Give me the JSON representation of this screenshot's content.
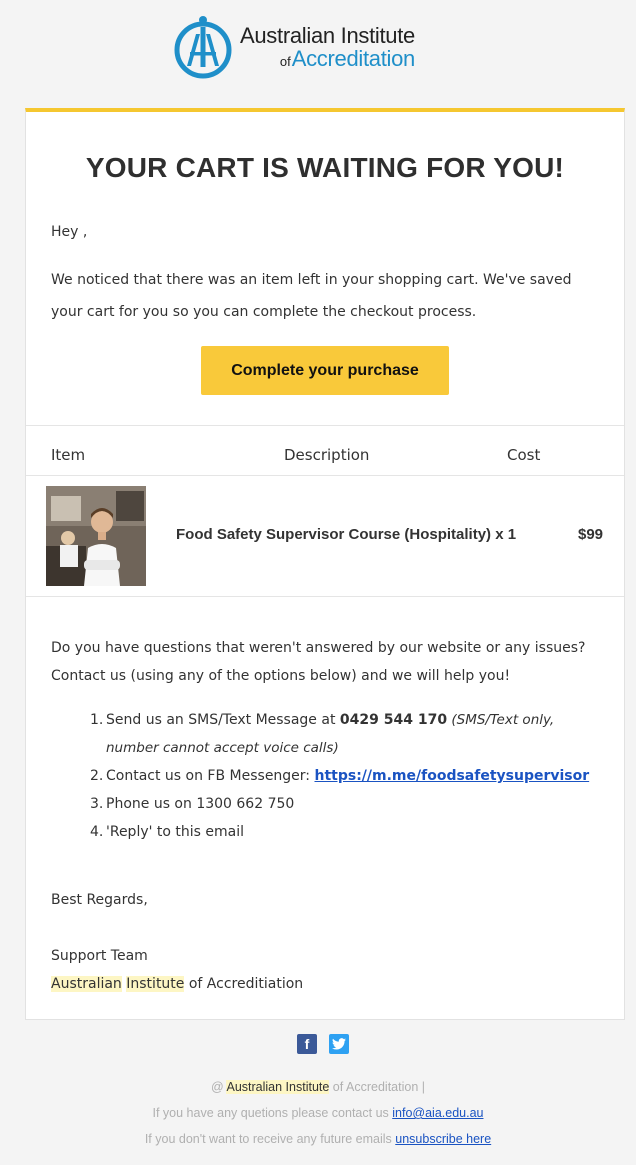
{
  "brand": {
    "name_line1": "Australian Institute",
    "name_of": "of",
    "name_line2": "Accreditation",
    "accent_color": "#1f8fc9",
    "highlight_color": "#f5c730"
  },
  "email": {
    "title": "YOUR CART IS WAITING FOR YOU!",
    "greeting": "Hey ,",
    "intro": "We noticed that there was an item left in your shopping cart. We've saved your cart for you so you can complete the checkout process.",
    "cta_label": "Complete your purchase"
  },
  "table": {
    "headers": [
      "Item",
      "Description",
      "Cost"
    ],
    "rows": [
      {
        "image_icon": "product-photo-chef",
        "description": "Food Safety Supervisor Course (Hospitality) x 1",
        "cost": "$99"
      }
    ]
  },
  "support": {
    "questions": "Do you have questions that weren't answered by our website or any issues? Contact us (using any of the options below) and we will help you!",
    "options": [
      {
        "num": "1.",
        "prefix": "Send us an SMS/Text Message at ",
        "strong": "0429 544 170",
        "note": " (SMS/Text only, number cannot accept voice calls)"
      },
      {
        "num": "2.",
        "prefix": "Contact us on FB Messenger: ",
        "link": "https://m.me/foodsafetysupervisor"
      },
      {
        "num": "3.",
        "text": "Phone us on 1300 662 750"
      },
      {
        "num": "4.",
        "text": "'Reply' to this email"
      }
    ],
    "regards": "Best Regards,",
    "team": "Support Team",
    "org_hl1": "Australian",
    "org_hl2": "Institute",
    "org_rest": "of Accreditiation"
  },
  "social": {
    "facebook_icon": "facebook-icon",
    "twitter_icon": "twitter-icon"
  },
  "footer": {
    "copyright_prefix": "@ ",
    "copyright_hl": "Australian Institute",
    "copyright_rest": " of Accreditation |",
    "contact_text": "If you have any quetions please contact us ",
    "contact_email": "info@aia.edu.au",
    "unsub_text": "If you don't want to receive any future emails ",
    "unsub_link": "unsubscribe here"
  }
}
